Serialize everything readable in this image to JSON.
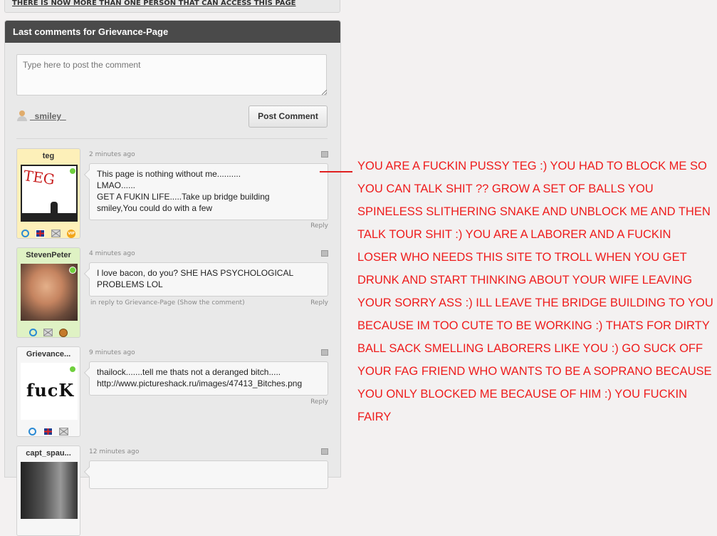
{
  "top_notice": "THERE IS NOW MORE THAN ONE PERSON THAT CAN ACCESS THIS PAGE",
  "panel": {
    "title": "Last comments for Grievance-Page",
    "comment_placeholder": "Type here to post the comment",
    "current_user": "_smiley_",
    "post_button": "Post Comment"
  },
  "comments": [
    {
      "author": "teg",
      "time": "2 minutes ago",
      "text": "This page is nothing without me..........\nLMAO......\nGET A FUKIN LIFE.....Take up bridge building\nsmiley,You could do with a few",
      "reply": "Reply",
      "avatar_text": "TEG",
      "badges": [
        "male-icon",
        "uk-flag-icon",
        "mail-icon",
        "vip-icon"
      ],
      "vip_text": "VIP"
    },
    {
      "author": "StevenPeter",
      "time": "4 minutes ago",
      "text": "I love bacon, do you? SHE HAS PSYCHOLOGICAL\nPROBLEMS LOL",
      "in_reply_to": "in reply to Grievance-Page (Show the comment)",
      "reply": "Reply",
      "badges": [
        "male-icon",
        "mail-icon",
        "dog-icon"
      ]
    },
    {
      "author": "Grievance...",
      "time": "9 minutes ago",
      "text": "thailock.......tell me thats not a deranged bitch.....\nhttp://www.pictureshack.ru/images/47413_Bitches.png",
      "reply": "Reply",
      "avatar_text": "fucK",
      "badges": [
        "male-icon",
        "uk-flag-icon",
        "mail-icon"
      ]
    },
    {
      "author": "capt_spau...",
      "time": "12 minutes ago"
    }
  ],
  "annotation": "YOU ARE A FUCKIN PUSSY TEG :) YOU HAD TO BLOCK ME SO YOU CAN TALK SHIT ?? GROW A SET OF BALLS YOU SPINELESS SLITHERING SNAKE AND UNBLOCK ME AND THEN TALK TOUR SHIT :) YOU ARE A LABORER AND A FUCKIN LOSER WHO NEEDS THIS SITE TO TROLL WHEN YOU GET DRUNK AND START THINKING ABOUT YOUR WIFE LEAVING YOUR SORRY ASS :) ILL LEAVE THE BRIDGE BUILDING TO YOU BECAUSE IM TOO CUTE TO BE WORKING :) THATS FOR DIRTY BALL SACK SMELLING LABORERS LIKE YOU :) GO SUCK OFF YOUR FAG FRIEND WHO WANTS TO BE A SOPRANO BECAUSE YOU ONLY BLOCKED ME BECAUSE OF HIM :) YOU FUCKIN FAIRY",
  "colors": {
    "annotation": "#ee1c1c",
    "header_bg": "#4a4a4a",
    "online": "#6fcf3d"
  }
}
